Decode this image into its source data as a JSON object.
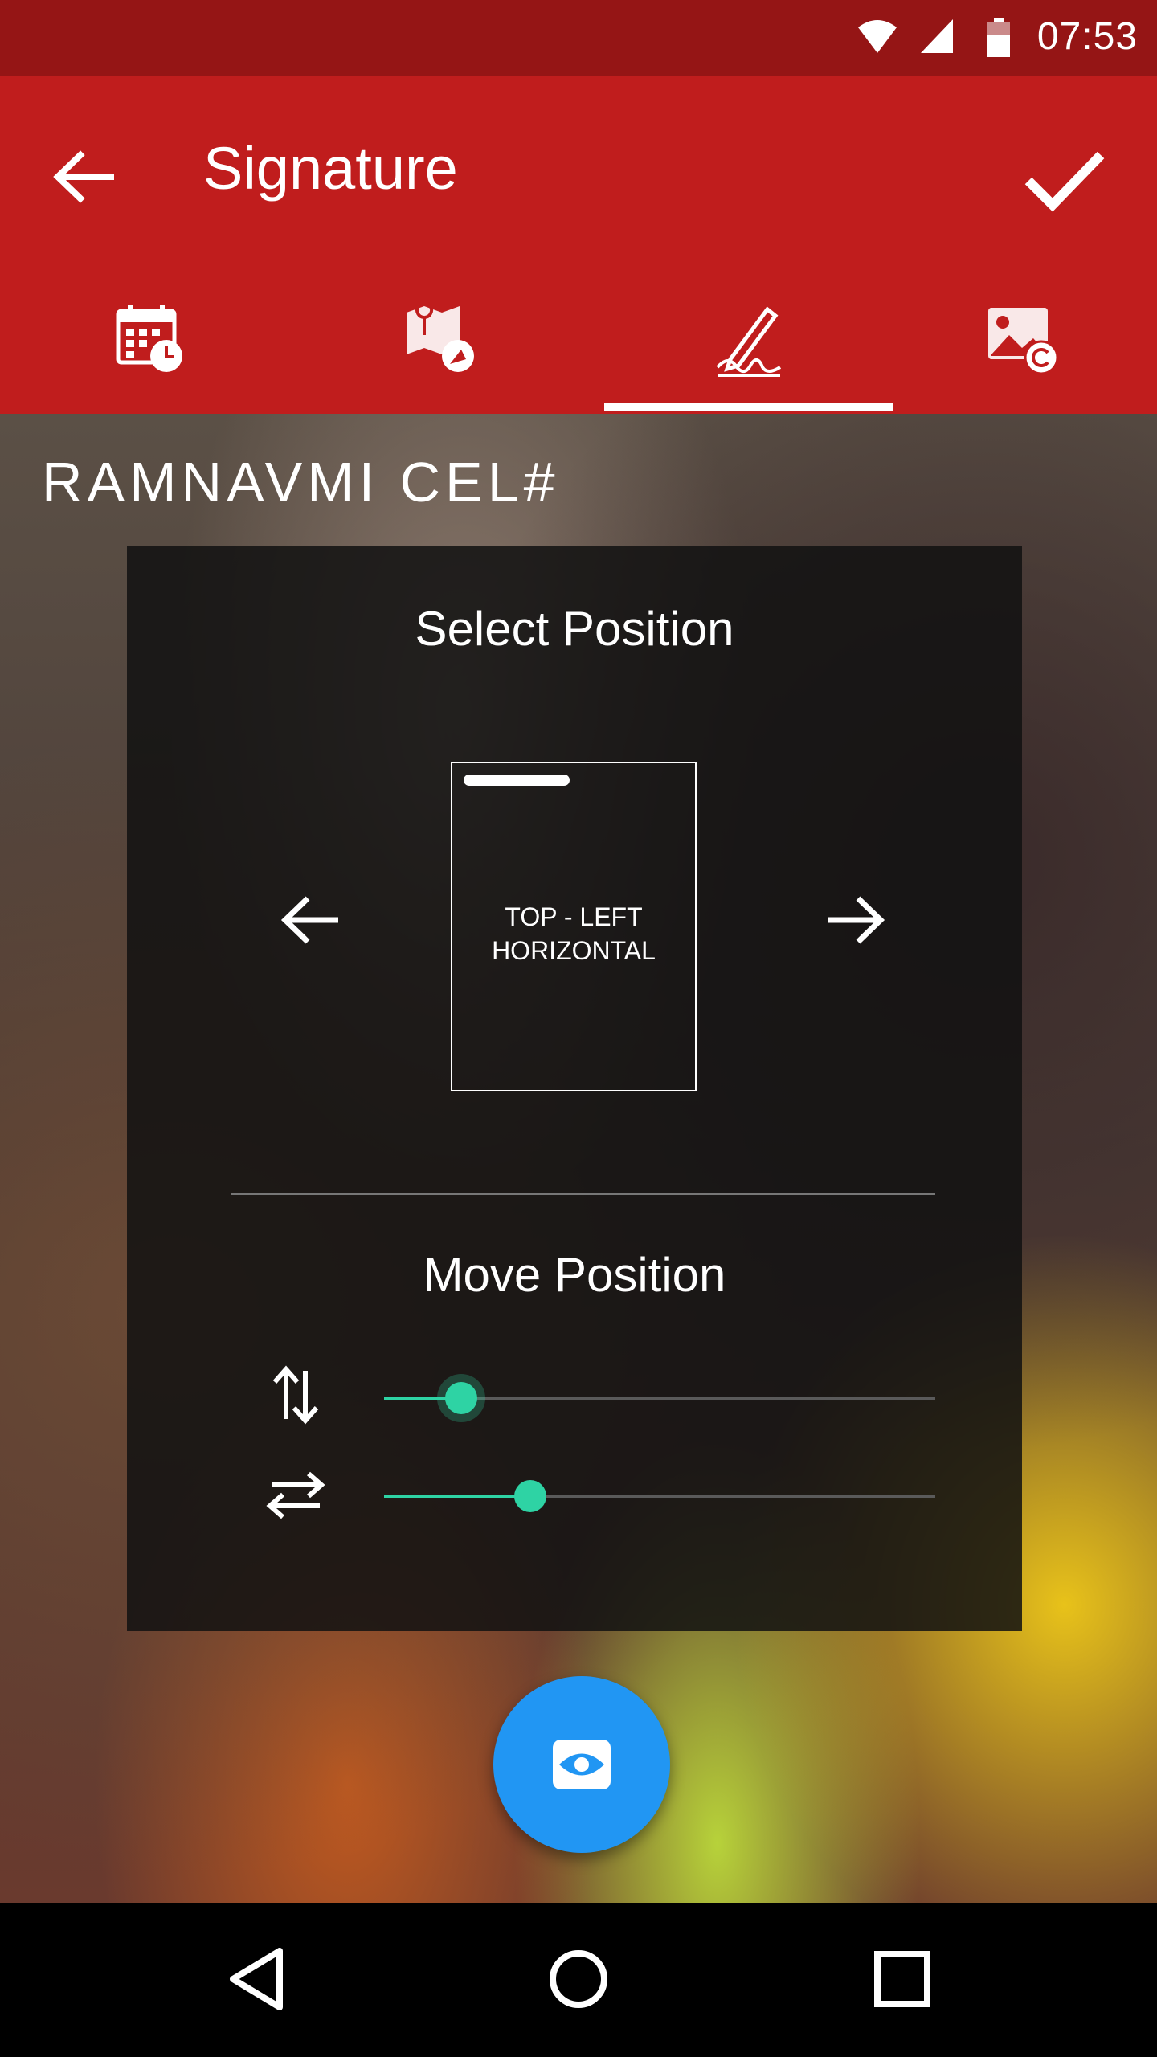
{
  "status_bar": {
    "time": "07:53",
    "icons": [
      "wifi-icon",
      "cell-signal-icon",
      "battery-icon"
    ]
  },
  "app_bar": {
    "title": "Signature",
    "back_icon": "arrow-left-icon",
    "confirm_icon": "check-icon",
    "tabs": [
      {
        "icon": "calendar-clock-icon",
        "selected": false
      },
      {
        "icon": "map-location-icon",
        "selected": false
      },
      {
        "icon": "signature-pen-icon",
        "selected": true
      },
      {
        "icon": "image-copyright-icon",
        "selected": false
      }
    ]
  },
  "photo": {
    "watermark_text": "RAMNAVMI CEL#"
  },
  "panel": {
    "select_title": "Select Position",
    "preview_line1": "TOP - LEFT",
    "preview_line2": "HORIZONTAL",
    "prev_icon": "arrow-left-icon",
    "next_icon": "arrow-right-icon",
    "move_title": "Move Position",
    "sliders": [
      {
        "icon": "vertical-arrows-icon",
        "value_fraction": 0.14
      },
      {
        "icon": "horizontal-arrows-icon",
        "value_fraction": 0.265
      }
    ],
    "accent_color": "#2ed3a4"
  },
  "fab": {
    "icon": "eye-icon",
    "color": "#2196f3"
  },
  "nav_bar": {
    "icons": [
      "back-triangle-icon",
      "home-circle-icon",
      "recents-square-icon"
    ]
  },
  "colors": {
    "status_bar": "#951515",
    "app_bar": "#c01d1d"
  }
}
